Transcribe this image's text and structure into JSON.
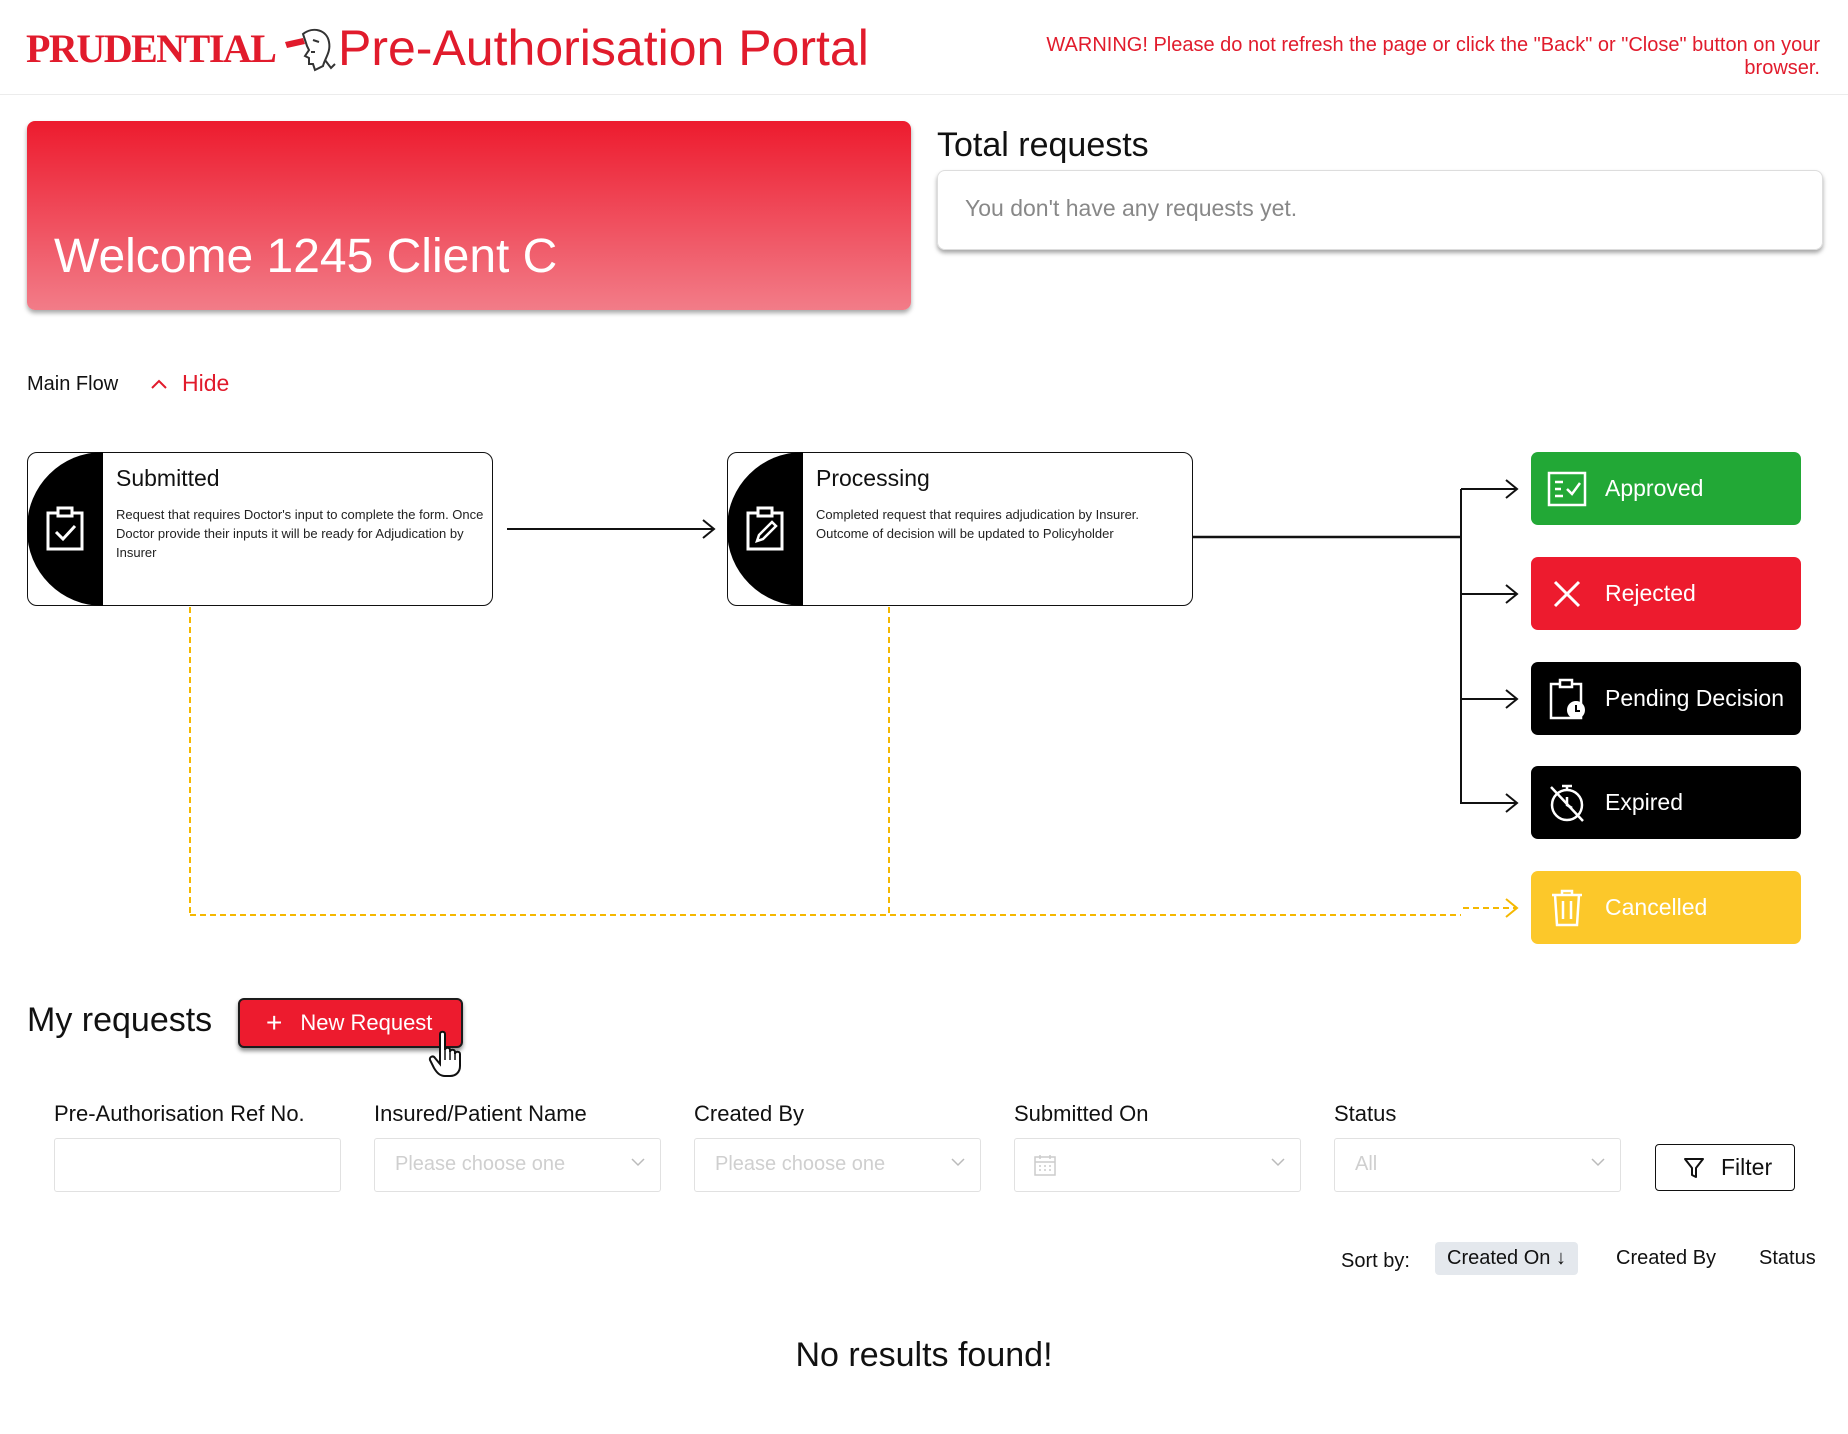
{
  "header": {
    "logo_text": "PRUDENTIAL",
    "title": "Pre-Authorisation Portal",
    "warning": "WARNING! Please do not refresh the page or click the \"Back\" or \"Close\" button on your browser."
  },
  "welcome": {
    "text": "Welcome 1245 Client C"
  },
  "total_requests": {
    "title": "Total requests",
    "empty_text": "You don't have any requests yet."
  },
  "flow": {
    "label": "Main Flow",
    "toggle_label": "Hide",
    "stages": [
      {
        "title": "Submitted",
        "description": "Request that requires Doctor's input to complete the form. Once Doctor provide their inputs it will be ready for Adjudication by Insurer",
        "icon": "clipboard-check-icon"
      },
      {
        "title": "Processing",
        "description": "Completed request that requires adjudication by Insurer. Outcome of decision will be updated to Policyholder",
        "icon": "clipboard-edit-icon"
      }
    ],
    "statuses": [
      {
        "label": "Approved",
        "icon": "checklist-icon",
        "color": "#22a836"
      },
      {
        "label": "Rejected",
        "icon": "close-icon",
        "color": "#ed1b2e"
      },
      {
        "label": "Pending Decision",
        "icon": "clipboard-clock-icon",
        "color": "#000000"
      },
      {
        "label": "Expired",
        "icon": "timer-off-icon",
        "color": "#000000"
      },
      {
        "label": "Cancelled",
        "icon": "trash-icon",
        "color": "#fcc82a"
      }
    ]
  },
  "my_requests": {
    "title": "My requests",
    "new_request_label": "New Request",
    "filters": [
      {
        "label": "Pre-Authorisation Ref No.",
        "placeholder": ""
      },
      {
        "label": "Insured/Patient Name",
        "placeholder": "Please choose one"
      },
      {
        "label": "Created By",
        "placeholder": "Please choose one"
      },
      {
        "label": "Submitted On",
        "placeholder": ""
      },
      {
        "label": "Status",
        "placeholder": "All"
      }
    ],
    "filter_button": "Filter",
    "sort": {
      "label": "Sort by:",
      "options": [
        "Created On ↓",
        "Created By",
        "Status"
      ],
      "active": "Created On ↓"
    },
    "empty_text": "No results found!"
  },
  "colors": {
    "brand_red": "#e11b2c",
    "accent_yellow": "#fcc82a",
    "approved_green": "#22a836"
  }
}
